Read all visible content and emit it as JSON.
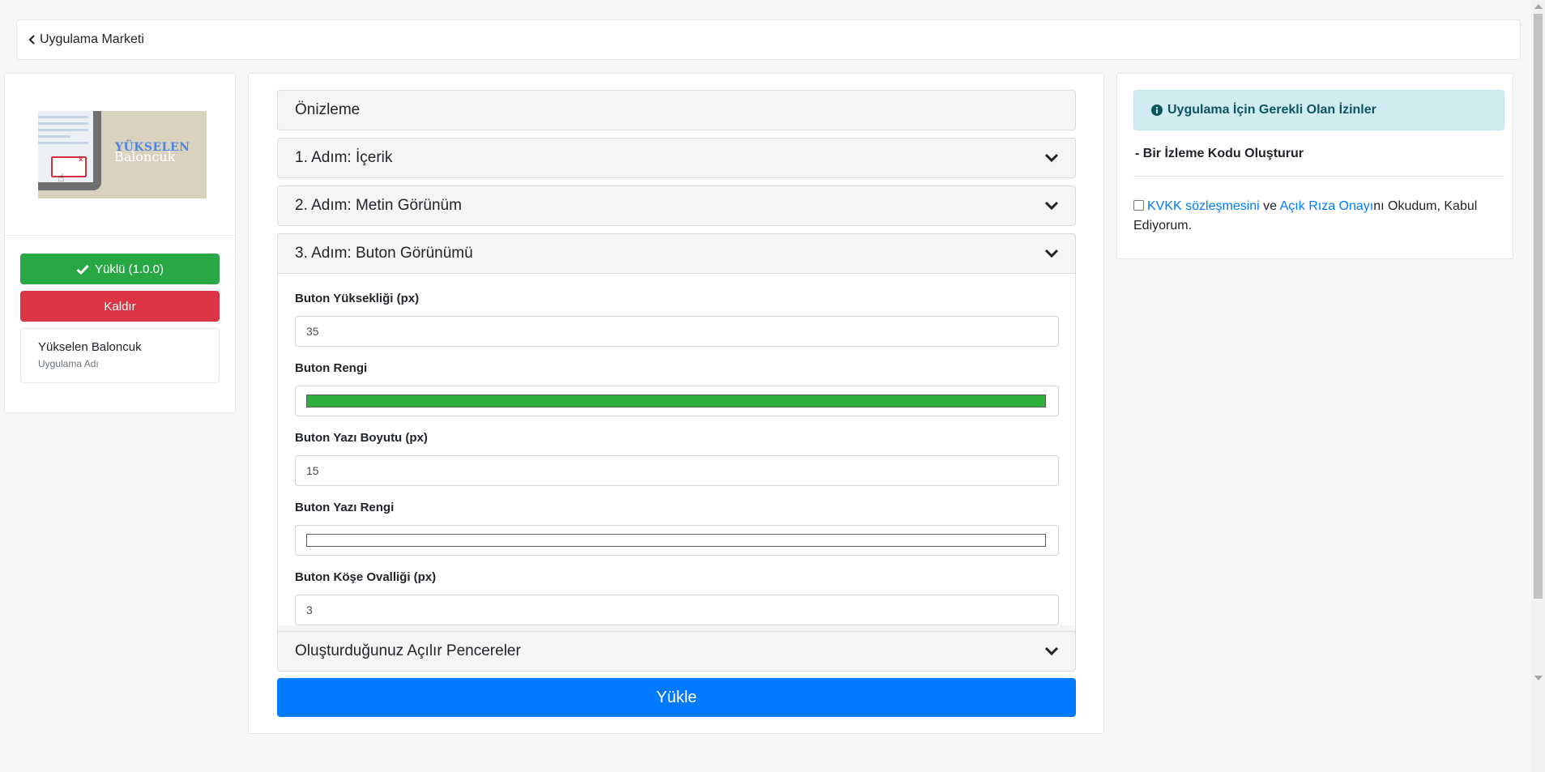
{
  "header": {
    "back_label": "Uygulama Marketi"
  },
  "app": {
    "thumb_title_line1": "YÜKSELEN",
    "thumb_title_line2": "Baloncuk",
    "installed_label": "Yüklü (1.0.0)",
    "remove_label": "Kaldır",
    "name": "Yükselen Baloncuk",
    "name_caption": "Uygulama Adı"
  },
  "accordion": [
    {
      "title": "Önizleme"
    },
    {
      "title": "1. Adım: İçerik"
    },
    {
      "title": "2. Adım: Metin Görünüm"
    },
    {
      "title": "3. Adım: Buton Görünümü"
    },
    {
      "title": "Oluşturduğunuz Açılır Pencereler"
    }
  ],
  "button_settings": {
    "height_label": "Buton Yüksekliği (px)",
    "height_value": "35",
    "color_label": "Buton Rengi",
    "color_value": "#2eb03d",
    "font_size_label": "Buton Yazı Boyutu (px)",
    "font_size_value": "15",
    "text_color_label": "Buton Yazı Rengi",
    "text_color_value": "#ffffff",
    "radius_label": "Buton Köşe Ovalliği (px)",
    "radius_value": "3"
  },
  "submit_label": "Yükle",
  "permissions": {
    "title": "Uygulama İçin Gerekli Olan İzinler",
    "item": "- Bir İzleme Kodu Oluşturur",
    "kvkk_link": "KVKK sözleşmesini",
    "and": " ve ",
    "consent_link": "Açık Rıza Onayı",
    "consent_rest": "nı Okudum, Kabul Ediyorum."
  }
}
